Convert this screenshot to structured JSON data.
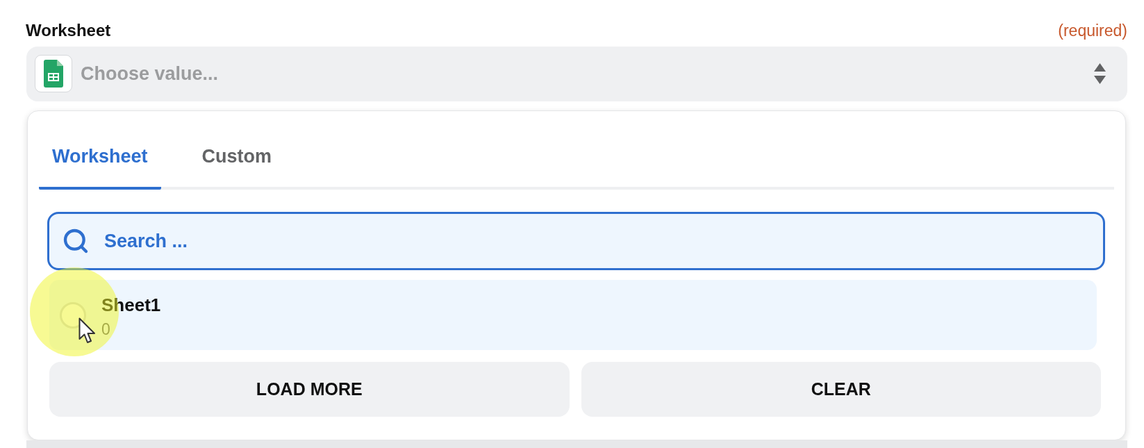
{
  "field": {
    "label": "Worksheet",
    "required_note": "(required)",
    "placeholder": "Choose value..."
  },
  "dropdown": {
    "tabs": [
      {
        "label": "Worksheet",
        "selected": true
      },
      {
        "label": "Custom",
        "selected": false
      }
    ],
    "search": {
      "placeholder": "Search ..."
    },
    "options": [
      {
        "title": "Sheet1",
        "subtitle": "0",
        "selected": false
      }
    ],
    "buttons": [
      "LOAD MORE",
      "CLEAR"
    ]
  }
}
